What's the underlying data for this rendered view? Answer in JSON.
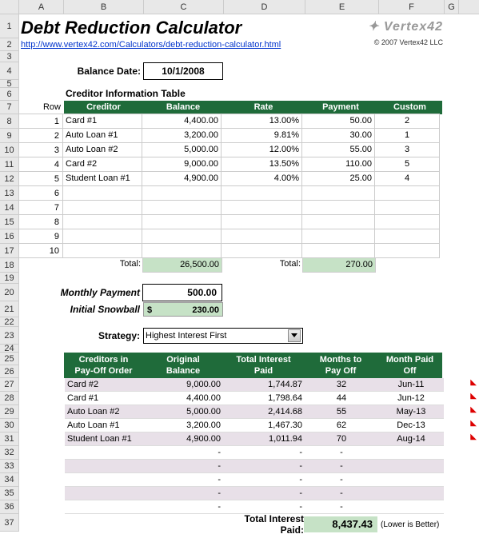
{
  "title": "Debt Reduction Calculator",
  "logo_text": "Vertex42",
  "link_url": "http://www.vertex42.com/Calculators/debt-reduction-calculator.html",
  "copyright": "© 2007 Vertex42 LLC",
  "balance_date_label": "Balance Date:",
  "balance_date": "10/1/2008",
  "creditor_table_title": "Creditor Information Table",
  "row_label": "Row",
  "creditor_headers": {
    "c1": "Creditor",
    "c2": "Balance",
    "c3": "Rate",
    "c4": "Payment",
    "c5": "Custom"
  },
  "creditors": [
    {
      "n": "1",
      "name": "Card #1",
      "balance": "4,400.00",
      "rate": "13.00%",
      "payment": "50.00",
      "custom": "2"
    },
    {
      "n": "2",
      "name": "Auto Loan #1",
      "balance": "3,200.00",
      "rate": "9.81%",
      "payment": "30.00",
      "custom": "1"
    },
    {
      "n": "3",
      "name": "Auto Loan #2",
      "balance": "5,000.00",
      "rate": "12.00%",
      "payment": "55.00",
      "custom": "3"
    },
    {
      "n": "4",
      "name": "Card #2",
      "balance": "9,000.00",
      "rate": "13.50%",
      "payment": "110.00",
      "custom": "5"
    },
    {
      "n": "5",
      "name": "Student Loan #1",
      "balance": "4,900.00",
      "rate": "4.00%",
      "payment": "25.00",
      "custom": "4"
    },
    {
      "n": "6",
      "name": "",
      "balance": "",
      "rate": "",
      "payment": "",
      "custom": ""
    },
    {
      "n": "7",
      "name": "",
      "balance": "",
      "rate": "",
      "payment": "",
      "custom": ""
    },
    {
      "n": "8",
      "name": "",
      "balance": "",
      "rate": "",
      "payment": "",
      "custom": ""
    },
    {
      "n": "9",
      "name": "",
      "balance": "",
      "rate": "",
      "payment": "",
      "custom": ""
    },
    {
      "n": "10",
      "name": "",
      "balance": "",
      "rate": "",
      "payment": "",
      "custom": ""
    }
  ],
  "totals": {
    "label": "Total:",
    "balance": "26,500.00",
    "payment_label": "Total:",
    "payment": "270.00"
  },
  "monthly_payment_label": "Monthly Payment",
  "monthly_payment": "500.00",
  "initial_snowball_label": "Initial Snowball",
  "snowball_currency": "$",
  "initial_snowball": "230.00",
  "strategy_label": "Strategy:",
  "strategy_value": "Highest Interest First",
  "payoff_headers": {
    "c1a": "Creditors in",
    "c1b": "Pay-Off Order",
    "c2a": "Original",
    "c2b": "Balance",
    "c3a": "Total Interest",
    "c3b": "Paid",
    "c4a": "Months to",
    "c4b": "Pay Off",
    "c5a": "Month Paid",
    "c5b": "Off"
  },
  "payoff": [
    {
      "name": "Card #2",
      "balance": "9,000.00",
      "interest": "1,744.87",
      "months": "32",
      "month": "Jun-11"
    },
    {
      "name": "Card #1",
      "balance": "4,400.00",
      "interest": "1,798.64",
      "months": "44",
      "month": "Jun-12"
    },
    {
      "name": "Auto Loan #2",
      "balance": "5,000.00",
      "interest": "2,414.68",
      "months": "55",
      "month": "May-13"
    },
    {
      "name": "Auto Loan #1",
      "balance": "3,200.00",
      "interest": "1,467.30",
      "months": "62",
      "month": "Dec-13"
    },
    {
      "name": "Student Loan #1",
      "balance": "4,900.00",
      "interest": "1,011.94",
      "months": "70",
      "month": "Aug-14"
    },
    {
      "name": "",
      "balance": "-",
      "interest": "-",
      "months": "-",
      "month": ""
    },
    {
      "name": "",
      "balance": "-",
      "interest": "-",
      "months": "-",
      "month": ""
    },
    {
      "name": "",
      "balance": "-",
      "interest": "-",
      "months": "-",
      "month": ""
    },
    {
      "name": "",
      "balance": "-",
      "interest": "-",
      "months": "-",
      "month": ""
    },
    {
      "name": "",
      "balance": "-",
      "interest": "-",
      "months": "-",
      "month": ""
    }
  ],
  "final_label": "Total Interest Paid:",
  "final_value": "8,437.43",
  "final_note": "(Lower is Better)",
  "col_letters": [
    "A",
    "B",
    "C",
    "D",
    "E",
    "F",
    "G"
  ]
}
